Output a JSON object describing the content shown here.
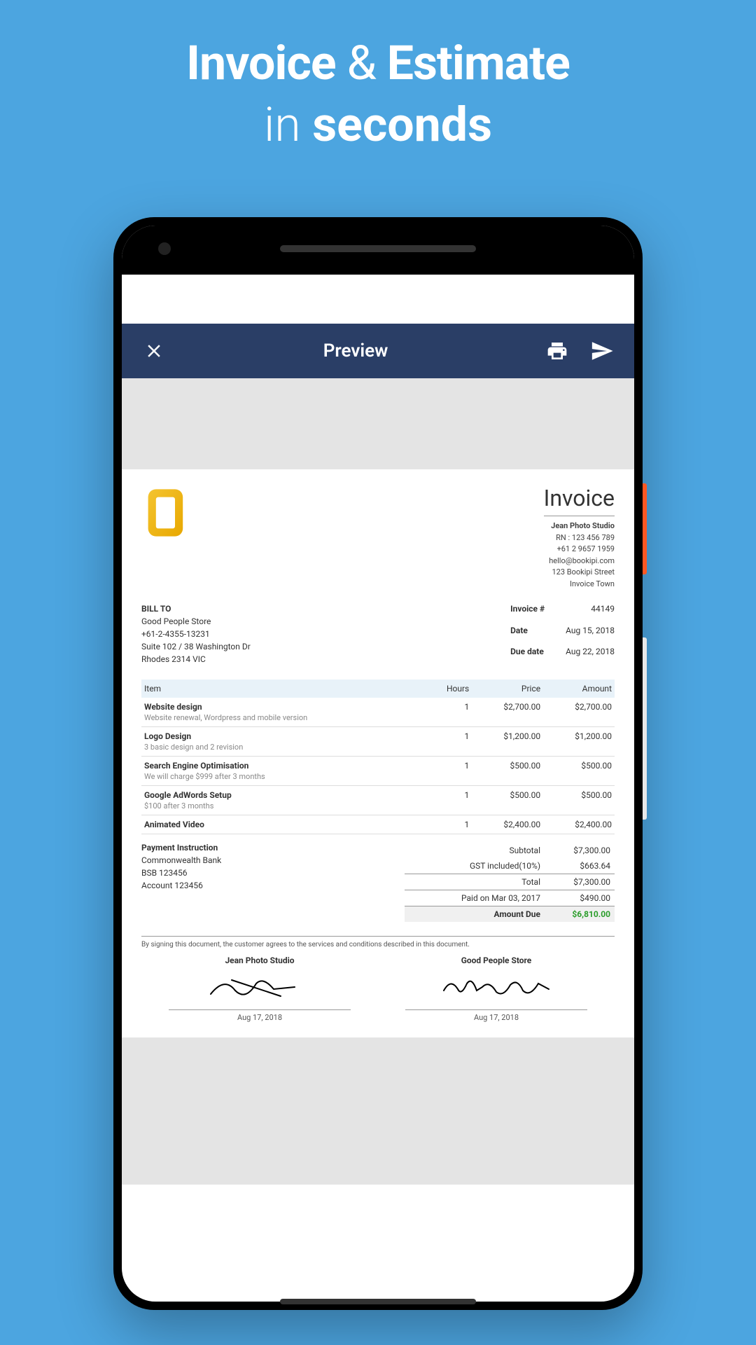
{
  "promo": {
    "line1_part1": "Invoice",
    "line1_amp": "&",
    "line1_part2": "Estimate",
    "line2_part1": "in",
    "line2_part2": "seconds"
  },
  "header": {
    "title": "Preview"
  },
  "invoice": {
    "doc_title": "Invoice",
    "company": {
      "name": "Jean Photo Studio",
      "rn": "RN : 123 456 789",
      "phone": "+61 2 9657 1959",
      "email": "hello@bookipi.com",
      "street": "123 Bookipi Street",
      "city": "Invoice Town"
    },
    "bill_to": {
      "label": "BILL TO",
      "name": "Good People Store",
      "phone": "+61-2-4355-13231",
      "street": "Suite 102 / 38 Washington Dr",
      "city": "Rhodes 2314 VIC"
    },
    "meta": {
      "invoice_no_label": "Invoice #",
      "invoice_no": "44149",
      "date_label": "Date",
      "date": "Aug 15, 2018",
      "due_label": "Due date",
      "due": "Aug 22, 2018"
    },
    "columns": {
      "item": "Item",
      "hours": "Hours",
      "price": "Price",
      "amount": "Amount"
    },
    "items": [
      {
        "name": "Website design",
        "desc": "Website renewal, Wordpress and mobile version",
        "hours": "1",
        "price": "$2,700.00",
        "amount": "$2,700.00"
      },
      {
        "name": "Logo Design",
        "desc": "3 basic design and 2 revision",
        "hours": "1",
        "price": "$1,200.00",
        "amount": "$1,200.00"
      },
      {
        "name": "Search Engine Optimisation",
        "desc": "We will charge $999 after 3 months",
        "hours": "1",
        "price": "$500.00",
        "amount": "$500.00"
      },
      {
        "name": "Google AdWords Setup",
        "desc": "$100 after 3 months",
        "hours": "1",
        "price": "$500.00",
        "amount": "$500.00"
      },
      {
        "name": "Animated Video",
        "desc": "",
        "hours": "1",
        "price": "$2,400.00",
        "amount": "$2,400.00"
      }
    ],
    "payment": {
      "label": "Payment Instruction",
      "bank": "Commonwealth Bank",
      "bsb": "BSB 123456",
      "account": "Account 123456"
    },
    "totals": {
      "subtotal_label": "Subtotal",
      "subtotal": "$7,300.00",
      "gst_label": "GST included(10%)",
      "gst": "$663.64",
      "total_label": "Total",
      "total": "$7,300.00",
      "paid_label": "Paid on Mar 03, 2017",
      "paid": "$490.00",
      "due_label": "Amount Due",
      "due": "$6,810.00"
    },
    "signatures": {
      "disclaimer": "By signing this document, the customer agrees to the services and conditions described in this document.",
      "left_name": "Jean Photo Studio",
      "left_date": "Aug 17, 2018",
      "right_name": "Good People Store",
      "right_date": "Aug 17, 2018"
    }
  }
}
